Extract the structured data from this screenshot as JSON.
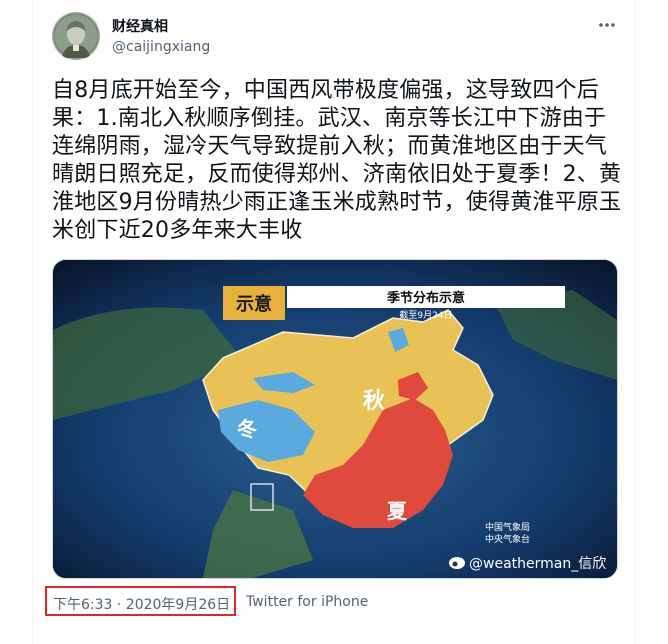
{
  "author": {
    "name": "财经真相",
    "handle": "@caijingxiang",
    "avatar_icon": "banknote-portrait-avatar"
  },
  "tweet": {
    "text": "自8月底开始至今，中国西风带极度偏强，这导致四个后果：1.南北入秋顺序倒挂。武汉、南京等长江中下游由于连绵阴雨，湿冷天气导致提前入秋；而黄淮地区由于天气晴朗日照充足，反而使得郑州、济南依旧处于夏季！2、黄淮地区9月份晴热少雨正逢玉米成熟时节，使得黄淮平原玉米创下近20多年来大丰收"
  },
  "media": {
    "badge": "示意",
    "title": "季节分布示意",
    "subtitle": "截至9月24日",
    "label_autumn": "秋",
    "label_winter": "冬",
    "label_summer": "夏",
    "agency_line1": "中国气象局",
    "agency_line2": "中央气象台",
    "watermark": "@weatherman_信欣",
    "colors": {
      "autumn": "#e8c255",
      "winter": "#5aa9df",
      "summer": "#e04a3c",
      "ocean": "#123a6b"
    }
  },
  "meta": {
    "timestamp": "下午6:33 · 2020年9月26日",
    "source": "Twitter for iPhone",
    "more_icon": "more-horizontal-icon"
  }
}
